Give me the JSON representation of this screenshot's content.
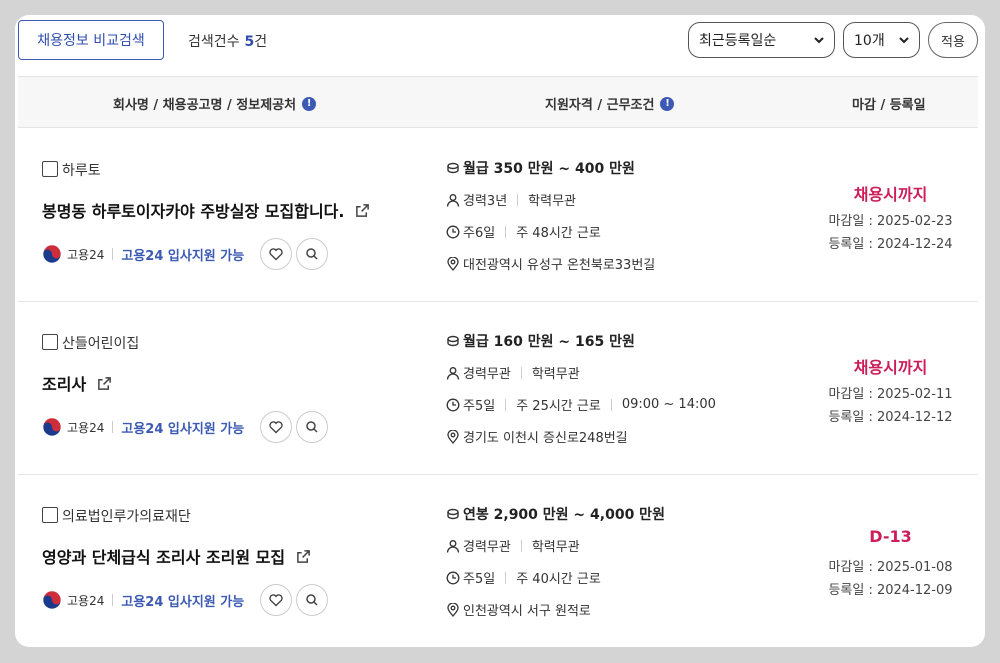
{
  "toolbar": {
    "compare_label": "채용정보 비교검색",
    "count_label": "검색건수",
    "count_value": "5",
    "count_unit": "건",
    "sort_selected": "최근등록일순",
    "size_selected": "10개",
    "apply_label": "적용"
  },
  "table_header": {
    "company_col": "회사명 / 채용공고명 / 정보제공처",
    "qual_col": "지원자격 / 근무조건",
    "date_col": "마감 / 등록일",
    "info_glyph": "!"
  },
  "icons": {
    "info": "info-icon",
    "external": "external-link-icon",
    "heart": "heart-icon",
    "search": "search-icon",
    "coin": "coin-icon",
    "person": "person-icon",
    "clock": "clock-icon",
    "location": "location-pin-icon",
    "chevron": "chevron-down-icon"
  },
  "colors": {
    "accent_blue": "#3c5ab4",
    "deadline_red": "#cc1f5a"
  },
  "rows": [
    {
      "company": "하루토",
      "title": "봉명동 하루토이자카야 주방실장 모집합니다.",
      "source_name": "고용24",
      "source_link": "고용24 입사지원 가능",
      "pay": "월급 350 만원 ~ 400 만원",
      "experience": "경력3년",
      "education": "학력무관",
      "days": "주6일",
      "hours": "주 48시간 근로",
      "work_time": "",
      "location": "대전광역시 유성구 온천북로33번길",
      "deadline": "채용시까지",
      "close_date": "마감일 : 2025-02-23",
      "reg_date": "등록일 : 2024-12-24"
    },
    {
      "company": "산들어린이집",
      "title": "조리사",
      "source_name": "고용24",
      "source_link": "고용24 입사지원 가능",
      "pay": "월급 160 만원 ~ 165 만원",
      "experience": "경력무관",
      "education": "학력무관",
      "days": "주5일",
      "hours": "주 25시간 근로",
      "work_time": "09:00 ~ 14:00",
      "location": "경기도 이천시 증신로248번길",
      "deadline": "채용시까지",
      "close_date": "마감일 : 2025-02-11",
      "reg_date": "등록일 : 2024-12-12"
    },
    {
      "company": "의료법인루가의료재단",
      "title": "영양과 단체급식 조리사 조리원 모집",
      "source_name": "고용24",
      "source_link": "고용24 입사지원 가능",
      "pay": "연봉 2,900 만원 ~ 4,000 만원",
      "experience": "경력무관",
      "education": "학력무관",
      "days": "주5일",
      "hours": "주 40시간 근로",
      "work_time": "",
      "location": "인천광역시 서구 원적로",
      "deadline": "D-13",
      "close_date": "마감일 : 2025-01-08",
      "reg_date": "등록일 : 2024-12-09"
    }
  ]
}
